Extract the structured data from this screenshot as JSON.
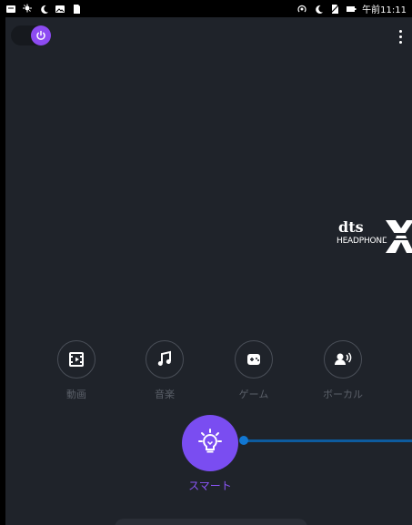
{
  "status_bar": {
    "time": "午前11:11",
    "left_icons": [
      "message-icon",
      "weather-icon",
      "moon-icon",
      "photo-icon",
      "sd-card-icon"
    ],
    "right_icons": [
      "hotspot-icon",
      "moon-icon",
      "no-sim-icon",
      "battery-icon"
    ]
  },
  "header": {
    "power_toggle": "on",
    "menu_icon": "kebab-menu-icon"
  },
  "branding": {
    "dts_text": "dts",
    "headphone_text": "HEADPHONE"
  },
  "modes": [
    {
      "label": "動画",
      "icon": "movie-icon"
    },
    {
      "label": "音楽",
      "icon": "music-note-icon"
    },
    {
      "label": "ゲーム",
      "icon": "gamepad-icon"
    },
    {
      "label": "ボーカル",
      "icon": "voice-icon"
    }
  ],
  "smart": {
    "label": "スマート",
    "icon": "bulb-icon"
  },
  "colors": {
    "background": "#1f232a",
    "accent": "#7a4df1",
    "slider": "#1177d2",
    "muted_text": "#5b6069"
  }
}
